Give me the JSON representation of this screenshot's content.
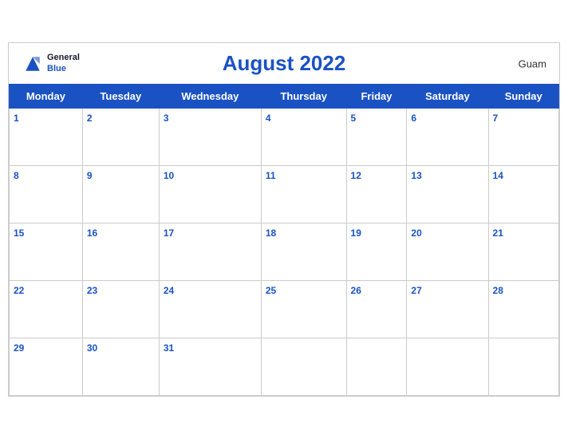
{
  "header": {
    "title": "August 2022",
    "country": "Guam",
    "logo_general": "General",
    "logo_blue": "Blue"
  },
  "weekdays": [
    "Monday",
    "Tuesday",
    "Wednesday",
    "Thursday",
    "Friday",
    "Saturday",
    "Sunday"
  ],
  "weeks": [
    [
      1,
      2,
      3,
      4,
      5,
      6,
      7
    ],
    [
      8,
      9,
      10,
      11,
      12,
      13,
      14
    ],
    [
      15,
      16,
      17,
      18,
      19,
      20,
      21
    ],
    [
      22,
      23,
      24,
      25,
      26,
      27,
      28
    ],
    [
      29,
      30,
      31,
      null,
      null,
      null,
      null
    ]
  ]
}
